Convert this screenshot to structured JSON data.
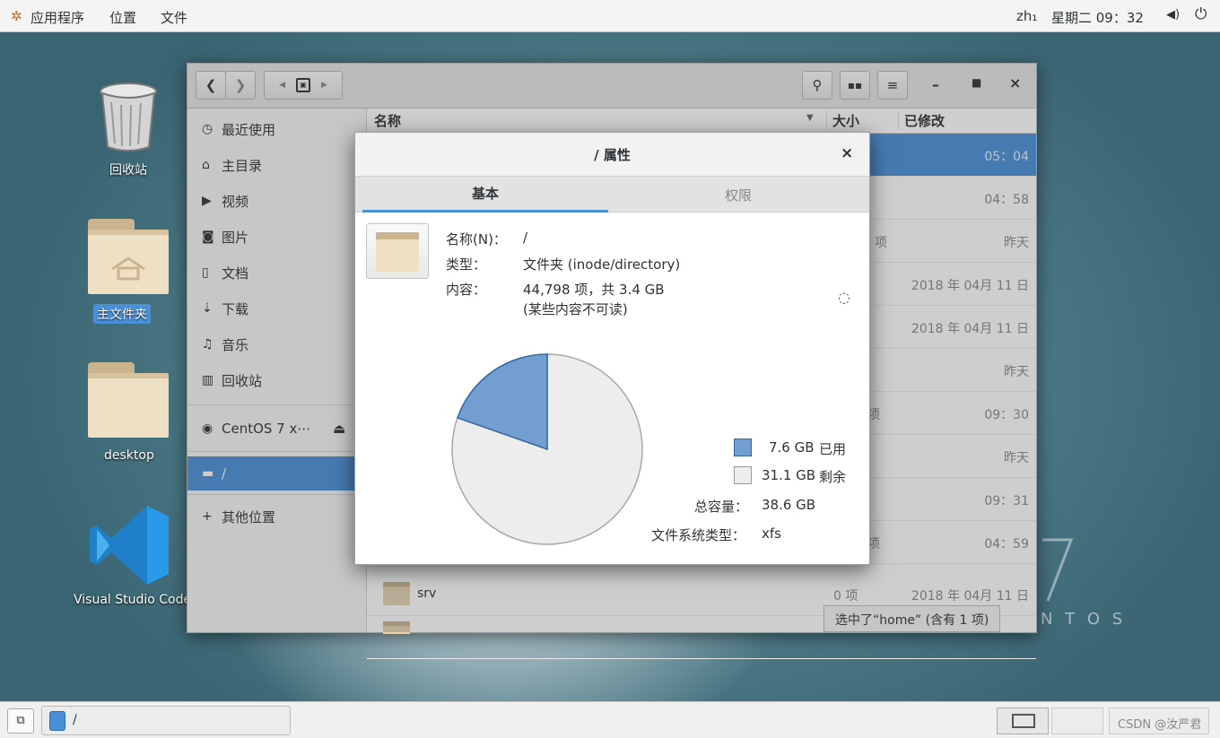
{
  "topbar": {
    "apps": "应用程序",
    "places": "位置",
    "files": "文件",
    "lang": "zh₁",
    "clock": "星期二 09：32"
  },
  "desktop": {
    "trash": "回收站",
    "home_folder": "主文件夹",
    "desktop_folder": "desktop",
    "vscode": "Visual Studio Code",
    "centos_watermark": "N T O S"
  },
  "sidebar": {
    "items": [
      {
        "label": "最近使用"
      },
      {
        "label": "主目录"
      },
      {
        "label": "视频"
      },
      {
        "label": "图片"
      },
      {
        "label": "文档"
      },
      {
        "label": "下载"
      },
      {
        "label": "音乐"
      },
      {
        "label": "回收站"
      },
      {
        "label": "CentOS 7 x⋯"
      },
      {
        "label": "/"
      },
      {
        "label": "其他位置"
      }
    ]
  },
  "list": {
    "col_name": "名称",
    "col_size": "大小",
    "col_modified": "已修改",
    "rows": [
      {
        "size": "",
        "modified": "05：04"
      },
      {
        "size": "",
        "modified": "04：58"
      },
      {
        "size": "项",
        "modified": "昨天"
      },
      {
        "size": "",
        "modified": "2018 年 04月 11 日"
      },
      {
        "size": "",
        "modified": "2018 年 04月 11 日"
      },
      {
        "size": "",
        "modified": "昨天"
      },
      {
        "size": "项",
        "modified": "09：30"
      },
      {
        "size": "",
        "modified": "昨天"
      },
      {
        "size": "",
        "modified": "09：31"
      },
      {
        "size": "项",
        "modified": "04：59"
      },
      {
        "name": "srv",
        "size": "0 项",
        "modified": "2018 年 04月 11 日"
      }
    ],
    "status": "选中了“home” (含有 1 项)"
  },
  "dialog": {
    "title": "/ 属性",
    "tab_basic": "基本",
    "tab_perm": "权限",
    "name_label": "名称(N)：",
    "name_value": "/",
    "type_label": "类型：",
    "type_value": "文件夹 (inode/directory)",
    "contents_label": "内容：",
    "contents_value": "44,798 项，共 3.4 GB",
    "contents_note": "(某些内容不可读)",
    "used_value": "7.6 GB",
    "used_label": "已用",
    "free_value": "31.1 GB",
    "free_label": "剩余",
    "total_label": "总容量：",
    "total_value": "38.6 GB",
    "fs_label": "文件系统类型：",
    "fs_value": "xfs"
  },
  "chart_data": {
    "type": "pie",
    "categories": [
      "已用",
      "剩余"
    ],
    "values": [
      7.6,
      31.1
    ],
    "colors": [
      "#729fcf",
      "#ededed"
    ]
  },
  "bottombar": {
    "window_title": "/",
    "watermark": "CSDN @汝严君"
  }
}
